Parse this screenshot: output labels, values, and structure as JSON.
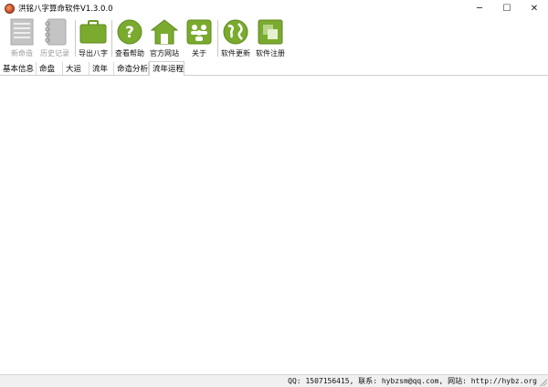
{
  "window": {
    "title": "洪铭八字算命软件V1.3.0.0",
    "controls": {
      "minimize": "─",
      "maximize": "☐",
      "close": "✕"
    }
  },
  "toolbar": {
    "items": [
      {
        "label": "新命造",
        "icon": "notepad-icon",
        "enabled": false
      },
      {
        "label": "历史记录",
        "icon": "notebook-icon",
        "enabled": false
      },
      {
        "label": "导出八字",
        "icon": "briefcase-icon",
        "enabled": true
      },
      {
        "label": "查看帮助",
        "icon": "help-icon",
        "enabled": true
      },
      {
        "label": "官方网站",
        "icon": "home-icon",
        "enabled": true
      },
      {
        "label": "关于",
        "icon": "people-icon",
        "enabled": true
      },
      {
        "label": "软件更新",
        "icon": "globe-icon",
        "enabled": true
      },
      {
        "label": "软件注册",
        "icon": "register-icon",
        "enabled": true
      }
    ]
  },
  "tabs": [
    {
      "label": "基本信息",
      "active": false
    },
    {
      "label": "命盘",
      "active": false
    },
    {
      "label": "大运",
      "active": false
    },
    {
      "label": "流年",
      "active": false
    },
    {
      "label": "命造分析",
      "active": false
    },
    {
      "label": "流年运程",
      "active": true
    }
  ],
  "status": {
    "text": "QQ: 1507156415, 联系: hybzsm@qq.com, 网站: http://hybz.org"
  },
  "colors": {
    "accent_green": "#7aaa2e",
    "disabled_gray": "#bcbcbc",
    "statusbar_bg": "#f0f0f0"
  }
}
